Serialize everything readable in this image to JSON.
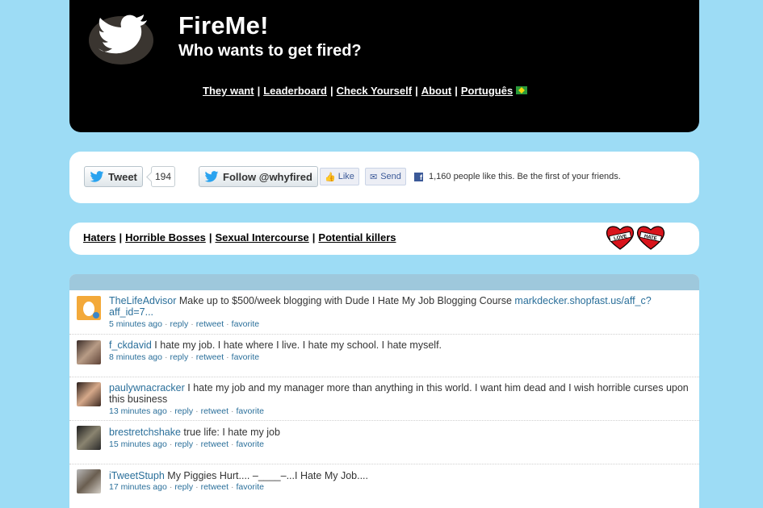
{
  "header": {
    "title": "FireMe!",
    "subtitle": "Who wants to get fired?",
    "nav": [
      "They want",
      "Leaderboard",
      "Check Yourself",
      "About",
      "Português"
    ]
  },
  "social": {
    "tweet_label": "Tweet",
    "tweet_count": "194",
    "follow_label": "Follow @whyfired",
    "like_label": "Like",
    "send_label": "Send",
    "fb_text": "1,160 people like this. Be the first of your friends."
  },
  "categories": [
    "Haters",
    "Horrible Bosses",
    "Sexual Intercourse",
    "Potential killers"
  ],
  "hearts": [
    "LOVE",
    "HATE"
  ],
  "meta_actions": [
    "reply",
    "retweet",
    "favorite"
  ],
  "tweets": [
    {
      "user": "TheLifeAdvisor",
      "text": "Make up to $500/week blogging with Dude I Hate My Job Blogging Course",
      "link": "markdecker.shopfast.us/aff_c?aff_id=7...",
      "time": "5 minutes ago"
    },
    {
      "user": "f_ckdavid",
      "text": "I hate my job. I hate where I live. I hate my school. I hate myself.",
      "link": "",
      "time": "8 minutes ago"
    },
    {
      "user": "paulywnacracker",
      "text": "I hate my job and my manager more than anything in this world. I want him dead and I wish horrible curses upon this business",
      "link": "",
      "time": "13 minutes ago"
    },
    {
      "user": "brestretchshake",
      "text": "true life: I hate my job",
      "link": "",
      "time": "15 minutes ago"
    },
    {
      "user": "iTweetStuph",
      "text": "My Piggies Hurt.... –____–...I Hate My Job....",
      "link": "",
      "time": "17 minutes ago"
    }
  ],
  "colors": {
    "page_bg": "#9ddcf5",
    "link": "#2a6f9a",
    "feed_header": "#9ec8dc"
  }
}
